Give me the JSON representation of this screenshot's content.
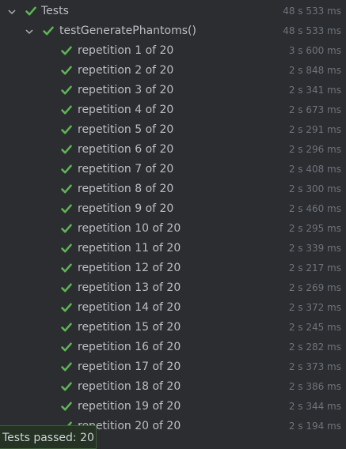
{
  "root": {
    "label": "Tests",
    "time": "48 s 533 ms",
    "status": "passed"
  },
  "method": {
    "label": "testGeneratePhantoms()",
    "time": "48 s 533 ms",
    "status": "passed"
  },
  "repetitions": [
    {
      "label": "repetition 1 of 20",
      "time": "3 s 600 ms"
    },
    {
      "label": "repetition 2 of 20",
      "time": "2 s 848 ms"
    },
    {
      "label": "repetition 3 of 20",
      "time": "2 s 341 ms"
    },
    {
      "label": "repetition 4 of 20",
      "time": "2 s 673 ms"
    },
    {
      "label": "repetition 5 of 20",
      "time": "2 s 291 ms"
    },
    {
      "label": "repetition 6 of 20",
      "time": "2 s 296 ms"
    },
    {
      "label": "repetition 7 of 20",
      "time": "2 s 408 ms"
    },
    {
      "label": "repetition 8 of 20",
      "time": "2 s 300 ms"
    },
    {
      "label": "repetition 9 of 20",
      "time": "2 s 460 ms"
    },
    {
      "label": "repetition 10 of 20",
      "time": "2 s 295 ms"
    },
    {
      "label": "repetition 11 of 20",
      "time": "2 s 339 ms"
    },
    {
      "label": "repetition 12 of 20",
      "time": "2 s 217 ms"
    },
    {
      "label": "repetition 13 of 20",
      "time": "2 s 269 ms"
    },
    {
      "label": "repetition 14 of 20",
      "time": "2 s 372 ms"
    },
    {
      "label": "repetition 15 of 20",
      "time": "2 s 245 ms"
    },
    {
      "label": "repetition 16 of 20",
      "time": "2 s 282 ms"
    },
    {
      "label": "repetition 17 of 20",
      "time": "2 s 373 ms"
    },
    {
      "label": "repetition 18 of 20",
      "time": "2 s 386 ms"
    },
    {
      "label": "repetition 19 of 20",
      "time": "2 s 344 ms"
    },
    {
      "label": "repetition 20 of 20",
      "time": "2 s 194 ms"
    }
  ],
  "status_popup": {
    "text": "Tests passed: 20"
  },
  "icons": {
    "expand": "chevron-down-icon",
    "passed": "check-icon"
  },
  "colors": {
    "background": "#2b2d30",
    "pass_green": "#5fb356",
    "text": "#bcbec4",
    "time_text": "#6f737a",
    "popup_background": "#253224"
  }
}
